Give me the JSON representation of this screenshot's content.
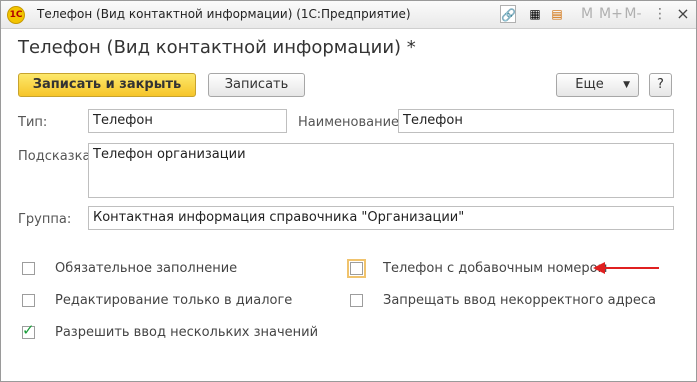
{
  "window": {
    "title": "Телефон (Вид контактной информации)  (1С:Предприятие)",
    "logo_text": "1С",
    "buttons": {
      "m": "M",
      "mplus": "M+",
      "mminus": "M-",
      "close": "×"
    }
  },
  "form": {
    "title": "Телефон (Вид контактной информации) *"
  },
  "toolbar": {
    "save_close_label": "Записать и закрыть",
    "save_label": "Записать",
    "more_label": "Еще",
    "help_label": "?"
  },
  "fields": {
    "type_label": "Тип:",
    "type_value": "Телефон",
    "name_label": "Наименование:",
    "name_value": "Телефон",
    "hint_label": "Подсказка:",
    "hint_value": "Телефон организации",
    "group_label": "Группа:",
    "group_value": "Контактная информация справочника \"Организации\""
  },
  "options": {
    "required": {
      "label": "Обязательное заполнение",
      "checked": false
    },
    "dialog_only": {
      "label": "Редактирование только в диалоге",
      "checked": false
    },
    "multiple": {
      "label": "Разрешить ввод нескольких значений",
      "checked": true
    },
    "extension": {
      "label": "Телефон с добавочным номером",
      "checked": false
    },
    "forbid_incorrect": {
      "label": "Запрещать ввод некорректного адреса",
      "checked": false
    }
  },
  "colors": {
    "accent": "#f6c52a",
    "arrow": "#e02020",
    "check": "#1a9c3a"
  }
}
